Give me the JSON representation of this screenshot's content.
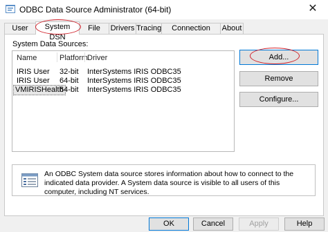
{
  "window": {
    "title": "ODBC Data Source Administrator (64-bit)",
    "close_glyph": "✕"
  },
  "tabs": [
    "User DSN",
    "System DSN",
    "File DSN",
    "Drivers",
    "Tracing",
    "Connection Pooling",
    "About"
  ],
  "active_tab": "System DSN",
  "panel": {
    "list_label": "System Data Sources:",
    "columns": [
      "Name",
      "Platform",
      "Driver"
    ],
    "rows": [
      {
        "name": "IRIS User",
        "platform": "32-bit",
        "driver": "InterSystems IRIS ODBC35"
      },
      {
        "name": "IRIS User",
        "platform": "64-bit",
        "driver": "InterSystems IRIS ODBC35"
      },
      {
        "name": "VMIRISHealth",
        "platform": "64-bit",
        "driver": "InterSystems IRIS ODBC35"
      }
    ],
    "selected_row": "VMIRISHealth",
    "buttons": {
      "add": "Add...",
      "remove": "Remove",
      "configure": "Configure..."
    },
    "info_text": "An ODBC System data source stores information about how to connect to the indicated data provider. A System data source is visible to all users of this computer, including NT services."
  },
  "footer": {
    "ok": "OK",
    "cancel": "Cancel",
    "apply": "Apply",
    "help": "Help"
  },
  "colors": {
    "annotation": "#d0212a",
    "focus": "#0078d7"
  },
  "icons": {
    "app": "odbc-app-icon",
    "info": "data-source-icon"
  }
}
